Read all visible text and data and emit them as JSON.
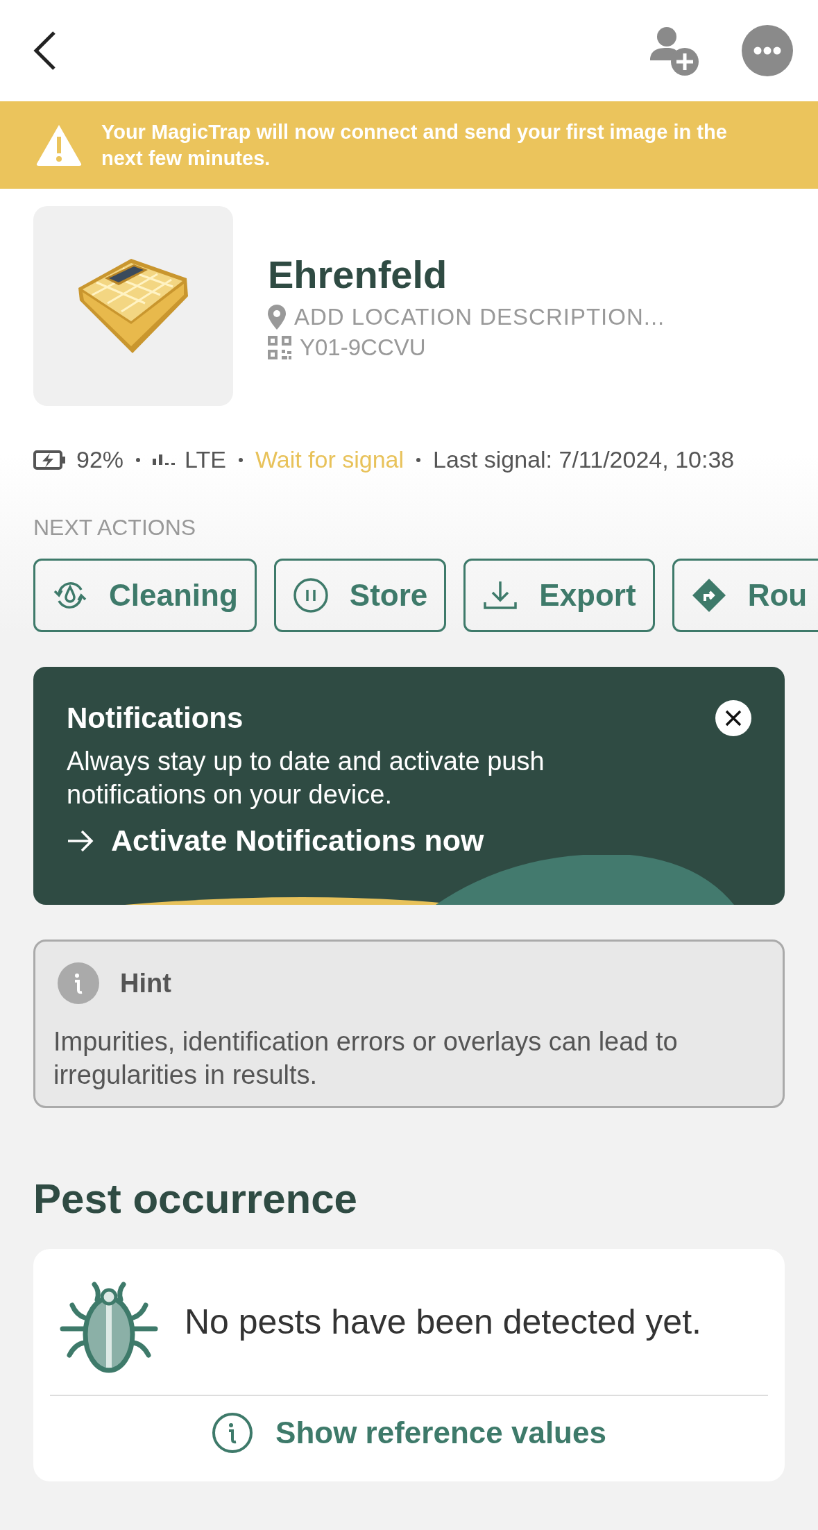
{
  "banner": {
    "text": "Your MagicTrap will now connect and send your first image in the next few minutes."
  },
  "trap": {
    "name": "Ehrenfeld",
    "location_hint": "ADD LOCATION DESCRIPTION...",
    "serial": "Y01-9CCVU"
  },
  "status": [
    {
      "kind": "battery",
      "text": "92%"
    },
    {
      "kind": "network",
      "text": "LTE"
    },
    {
      "kind": "connection",
      "text": "Wait for signal",
      "color": "#e8c25a"
    },
    {
      "kind": "text",
      "text": "Last signal: 7/11/2024, 10:38"
    }
  ],
  "next_actions": {
    "title": "NEXT ACTIONS",
    "buttons": [
      {
        "kind": "cleaning",
        "label": "Cleaning"
      },
      {
        "kind": "store",
        "label": "Store"
      },
      {
        "kind": "export",
        "label": "Export"
      },
      {
        "kind": "route",
        "label": "Rou"
      }
    ]
  },
  "notification": {
    "title": "Notifications",
    "text": "Always stay up to date and activate push notifications on your device.",
    "link": "Activate Notifications now"
  },
  "hint": {
    "title": "Hint",
    "text": "Impurities, identification errors or overlays can lead to irregularities in results."
  },
  "pests": {
    "title": "Pest occurrence",
    "empty_text": "No pests have been detected yet.",
    "link": "Show reference values"
  }
}
